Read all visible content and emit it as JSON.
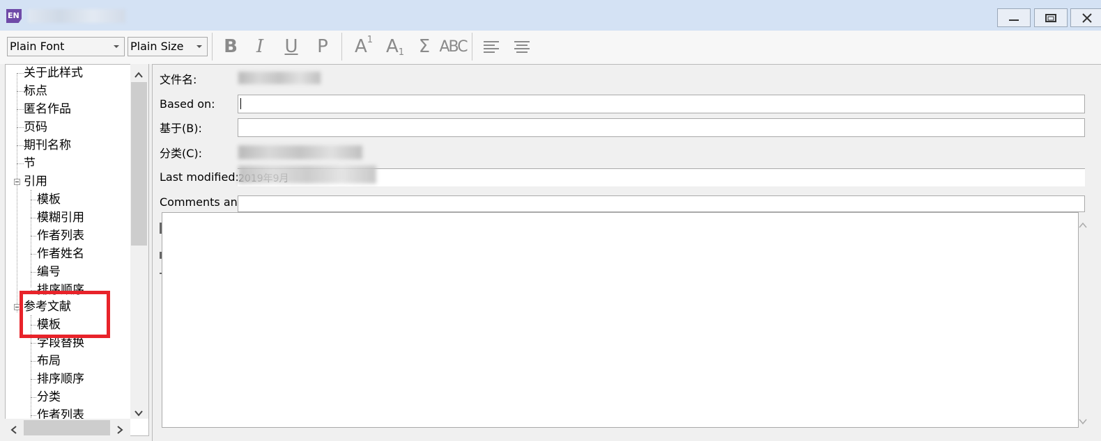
{
  "app": {
    "icon_text": "EN"
  },
  "toolbar": {
    "font_combo": "Plain Font",
    "size_combo": "Plain Size",
    "bold": "B",
    "italic": "I",
    "underline": "U",
    "plain": "P",
    "superscript": "A",
    "superscript_mark": "1",
    "subscript": "A",
    "subscript_mark": "1",
    "symbol": "Σ",
    "smallcaps": "ABC"
  },
  "tree": {
    "items": [
      "关于此样式",
      "标点",
      "匿名作品",
      "页码",
      "期刊名称",
      "节",
      "引用",
      "模板",
      "模糊引用",
      "作者列表",
      "作者姓名",
      "编号",
      "排序顺序",
      "参考文献",
      "模板",
      "字段替换",
      "布局",
      "排序顺序",
      "分类",
      "作者列表"
    ]
  },
  "form": {
    "filename_label": "文件名:",
    "based_on_label": "Based on:",
    "based_on_value": "",
    "based_on_cn_label": "基于(B):",
    "based_on_cn_value": "",
    "category_label": "分类(C):",
    "last_modified_label": "Last modified:",
    "last_modified_value": "2019年9月",
    "comments_label": "Comments and",
    "comments_value": ""
  },
  "colors": {
    "highlight": "#e8232a",
    "titlebar": "#d4e2f4"
  }
}
